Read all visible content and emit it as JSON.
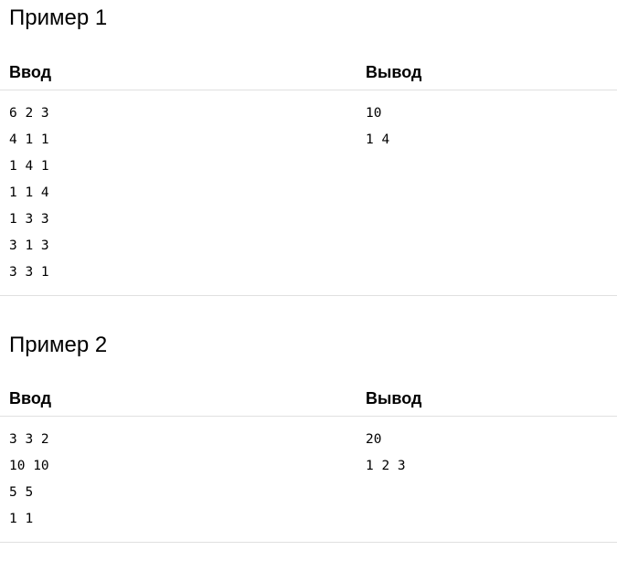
{
  "examples": [
    {
      "title": "Пример 1",
      "input_header": "Ввод",
      "output_header": "Вывод",
      "input_lines": [
        "6 2 3",
        "4 1 1",
        "1 4 1",
        "1 1 4",
        "1 3 3",
        "3 1 3",
        "3 3 1"
      ],
      "output_lines": [
        "10",
        "1 4"
      ]
    },
    {
      "title": "Пример 2",
      "input_header": "Ввод",
      "output_header": "Вывод",
      "input_lines": [
        "3 3 2",
        "10 10",
        "5 5",
        "1 1"
      ],
      "output_lines": [
        "20",
        "1 2 3"
      ]
    }
  ]
}
